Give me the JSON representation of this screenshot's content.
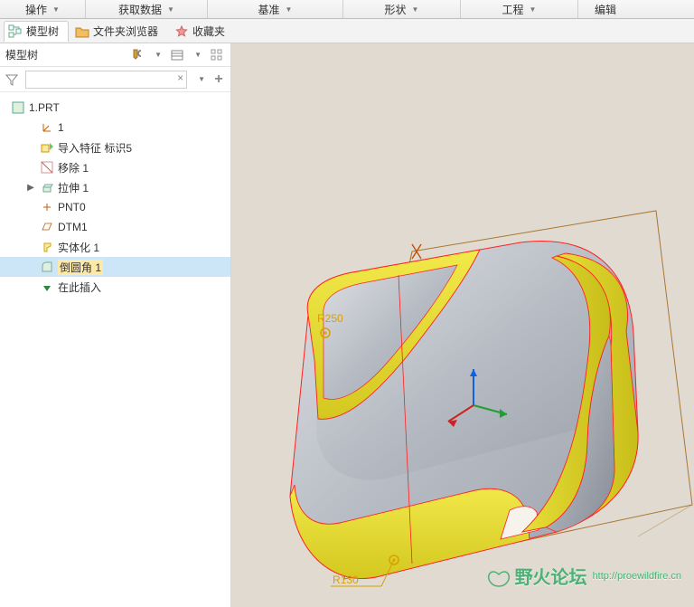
{
  "ribbon": {
    "tabs": [
      "操作",
      "获取数据",
      "基准",
      "形状",
      "工程",
      "编辑"
    ]
  },
  "subtabs": {
    "items": [
      {
        "label": "模型树",
        "active": true
      },
      {
        "label": "文件夹浏览器",
        "active": false
      },
      {
        "label": "收藏夹",
        "active": false
      }
    ]
  },
  "panel": {
    "title": "模型树"
  },
  "tree": {
    "root": "1.PRT",
    "items": [
      {
        "label": "1"
      },
      {
        "label": "导入特征 标识5"
      },
      {
        "label": "移除 1"
      },
      {
        "label": "拉伸 1",
        "expandable": true
      },
      {
        "label": "PNT0"
      },
      {
        "label": "DTM1"
      },
      {
        "label": "实体化 1"
      },
      {
        "label": "倒圆角 1",
        "selected": true
      },
      {
        "label": "在此插入"
      }
    ]
  },
  "viewport": {
    "labels": {
      "r1": "R250",
      "r2": "R130"
    }
  },
  "watermark": {
    "name": "野火论坛",
    "url": "http://proewildfire.cn"
  }
}
